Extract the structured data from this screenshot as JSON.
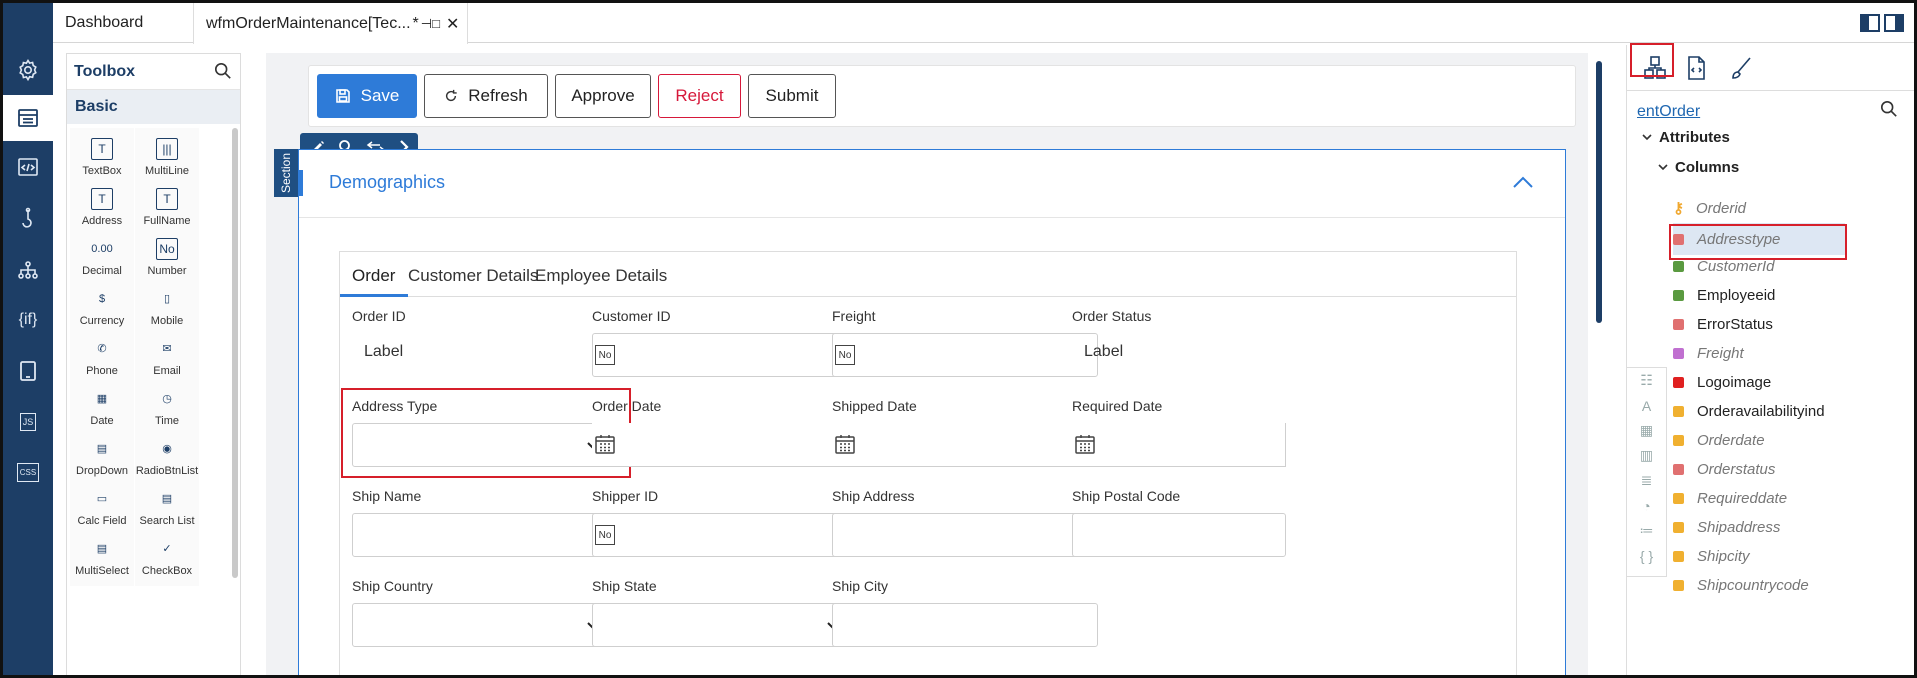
{
  "tabs": [
    {
      "label": "Dashboard"
    },
    {
      "label": "wfmOrderMaintenance[Tec...",
      "modified": "*",
      "pin": "⊣□",
      "close": "✕"
    }
  ],
  "rail_icons": [
    "gear-icon",
    "list-icon",
    "code-icon",
    "hook-icon",
    "hierarchy-icon",
    "if-icon",
    "tablet-icon",
    "js-icon",
    "css-icon"
  ],
  "rail_text": {
    "if": "{if}",
    "js": "JS",
    "css": "CSS"
  },
  "toolbox": {
    "title": "Toolbox",
    "group": "Basic",
    "items": [
      {
        "label": "TextBox",
        "icon": "T"
      },
      {
        "label": "MultiLine",
        "icon": "|||"
      },
      {
        "label": "Address",
        "icon": "T"
      },
      {
        "label": "FullName",
        "icon": "T"
      },
      {
        "label": "Decimal",
        "icon": "0.00"
      },
      {
        "label": "Number",
        "icon": "No"
      },
      {
        "label": "Currency",
        "icon": "$"
      },
      {
        "label": "Mobile",
        "icon": "▯"
      },
      {
        "label": "Phone",
        "icon": "✆"
      },
      {
        "label": "Email",
        "icon": "✉"
      },
      {
        "label": "Date",
        "icon": "▦"
      },
      {
        "label": "Time",
        "icon": "◷"
      },
      {
        "label": "DropDown",
        "icon": "▤"
      },
      {
        "label": "RadioBtnList",
        "icon": "◉"
      },
      {
        "label": "Calc Field",
        "icon": "▭"
      },
      {
        "label": "Search List",
        "icon": "▤"
      },
      {
        "label": "MultiSelect",
        "icon": "▤"
      },
      {
        "label": "CheckBox",
        "icon": "✓"
      }
    ]
  },
  "actions": {
    "save": "Save",
    "refresh": "Refresh",
    "approve": "Approve",
    "reject": "Reject",
    "submit": "Submit"
  },
  "section": {
    "side_label": "Section",
    "title": "Demographics"
  },
  "form": {
    "tabs": [
      "Order",
      "Customer Details",
      "Employee Details"
    ],
    "fields": {
      "order_id": {
        "label": "Order ID",
        "value": "Label"
      },
      "customer_id": {
        "label": "Customer ID",
        "icon": "No"
      },
      "freight": {
        "label": "Freight",
        "icon": "No"
      },
      "order_status": {
        "label": "Order Status",
        "value": "Label"
      },
      "address_type": {
        "label": "Address Type"
      },
      "order_date": {
        "label": "Order Date"
      },
      "shipped_date": {
        "label": "Shipped Date"
      },
      "required_date": {
        "label": "Required Date"
      },
      "ship_name": {
        "label": "Ship Name"
      },
      "shipper_id": {
        "label": "Shipper ID",
        "icon": "No"
      },
      "ship_address": {
        "label": "Ship Address"
      },
      "ship_postal_code": {
        "label": "Ship Postal Code"
      },
      "ship_country": {
        "label": "Ship Country"
      },
      "ship_state": {
        "label": "Ship State"
      },
      "ship_city": {
        "label": "Ship City"
      }
    }
  },
  "entity_panel": {
    "entity": "entOrder",
    "attributes_label": "Attributes",
    "columns_label": "Columns",
    "columns": [
      {
        "name": "Orderid",
        "color": "#f0a830",
        "key": true,
        "italic": true
      },
      {
        "name": "Addresstype",
        "color": "#e07070",
        "italic": true,
        "selected": true
      },
      {
        "name": "CustomerId",
        "color": "#5a9a40",
        "italic": true
      },
      {
        "name": "Employeeid",
        "color": "#5a9a40",
        "italic": false
      },
      {
        "name": "ErrorStatus",
        "color": "#e07070",
        "italic": false
      },
      {
        "name": "Freight",
        "color": "#c070d0",
        "italic": true
      },
      {
        "name": "Logoimage",
        "color": "#e02020",
        "italic": false
      },
      {
        "name": "Orderavailabilityind",
        "color": "#f0b030",
        "italic": false
      },
      {
        "name": "Orderdate",
        "color": "#f0b030",
        "italic": true
      },
      {
        "name": "Orderstatus",
        "color": "#e07070",
        "italic": true
      },
      {
        "name": "Requireddate",
        "color": "#f0b030",
        "italic": true
      },
      {
        "name": "Shipaddress",
        "color": "#f0b030",
        "italic": true
      },
      {
        "name": "Shipcity",
        "color": "#f0b030",
        "italic": true
      },
      {
        "name": "Shipcountrycode",
        "color": "#f0b030",
        "italic": true
      }
    ]
  },
  "colors": {
    "brand": "#1d3e66",
    "accent": "#2e7bd8",
    "danger": "#d6183a",
    "highlight": "#d61f2a"
  }
}
